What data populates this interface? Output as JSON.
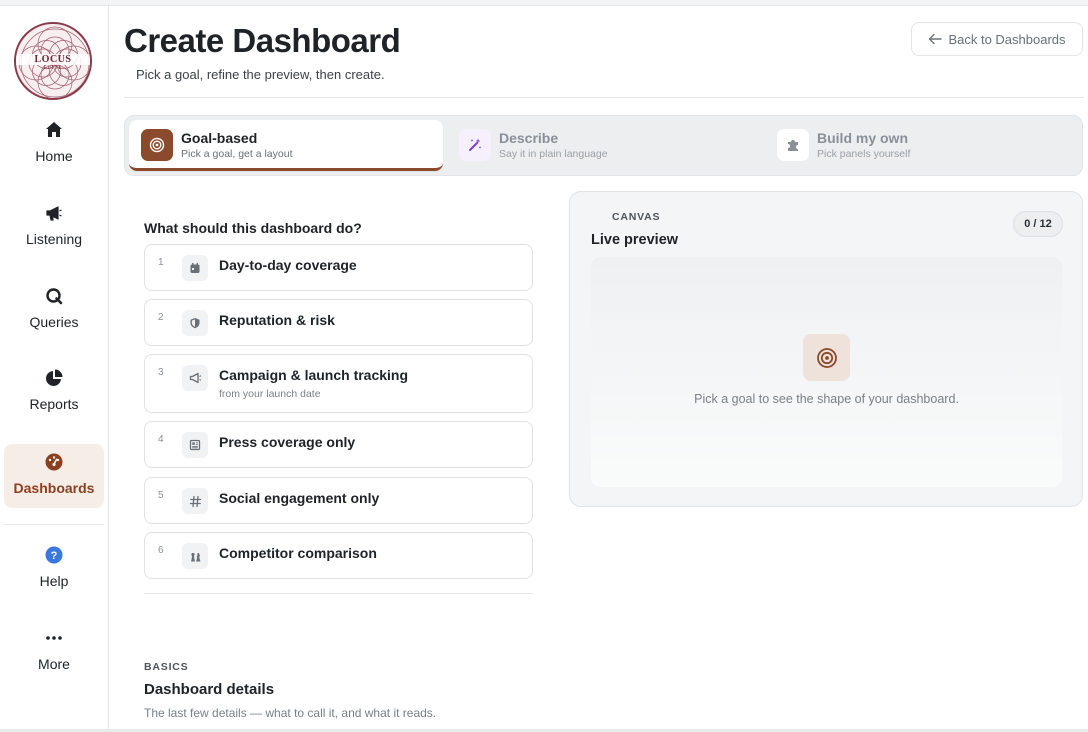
{
  "brand": {
    "logo_text": "LOCUS",
    "logo_subtext": "ELITE",
    "accent_color": "#8b4a2b",
    "logo_color": "#8b3a4a"
  },
  "sidebar": {
    "items": [
      {
        "label": "Home",
        "icon": "home-icon",
        "active": false
      },
      {
        "label": "Listening",
        "icon": "megaphone-icon",
        "active": false
      },
      {
        "label": "Queries",
        "icon": "query-icon",
        "active": false
      },
      {
        "label": "Reports",
        "icon": "pie-chart-icon",
        "active": false
      },
      {
        "label": "Dashboards",
        "icon": "gauge-icon",
        "active": true
      },
      {
        "label": "Help",
        "icon": "help-icon",
        "active": false
      },
      {
        "label": "More",
        "icon": "more-icon",
        "active": false
      }
    ]
  },
  "header": {
    "title": "Create Dashboard",
    "subtitle": "Pick a goal, refine the preview, then create.",
    "back_label": "Back to Dashboards"
  },
  "modes": [
    {
      "title": "Goal-based",
      "subtitle": "Pick a goal, get a layout",
      "icon": "target-icon",
      "active": true
    },
    {
      "title": "Describe",
      "subtitle": "Say it in plain language",
      "icon": "magic-wand-icon",
      "active": false
    },
    {
      "title": "Build my own",
      "subtitle": "Pick panels yourself",
      "icon": "puzzle-icon",
      "active": false
    }
  ],
  "goals": {
    "heading": "What should this dashboard do?",
    "items": [
      {
        "num": "1",
        "label": "Day-to-day coverage",
        "sub": "",
        "icon": "calendar-icon"
      },
      {
        "num": "2",
        "label": "Reputation & risk",
        "sub": "",
        "icon": "shield-icon"
      },
      {
        "num": "3",
        "label": "Campaign & launch tracking",
        "sub": "from your launch date",
        "icon": "megaphone-icon"
      },
      {
        "num": "4",
        "label": "Press coverage only",
        "sub": "",
        "icon": "newspaper-icon"
      },
      {
        "num": "5",
        "label": "Social engagement only",
        "sub": "",
        "icon": "hashtag-icon"
      },
      {
        "num": "6",
        "label": "Competitor comparison",
        "sub": "",
        "icon": "chess-icon"
      }
    ]
  },
  "canvas": {
    "eyebrow": "CANVAS",
    "title": "Live preview",
    "counter": "0 / 12",
    "empty_text": "Pick a goal to see the shape of your dashboard."
  },
  "basics": {
    "eyebrow": "BASICS",
    "title": "Dashboard details",
    "subtitle": "The last few details — what to call it, and what it reads."
  }
}
